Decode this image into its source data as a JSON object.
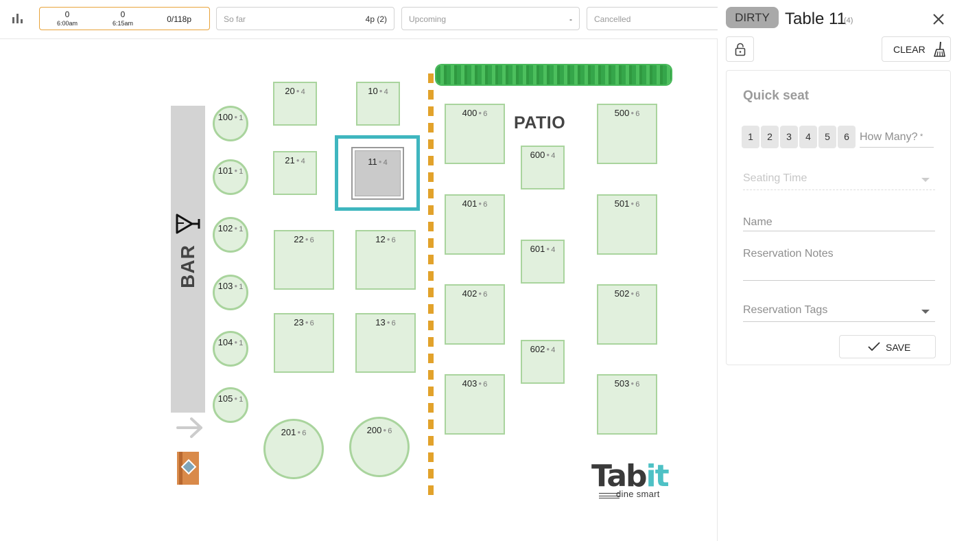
{
  "topbar": {
    "now": {
      "slots": [
        {
          "count": "0",
          "time": "6:00am"
        },
        {
          "count": "0",
          "time": "6:15am"
        }
      ],
      "total": "0/118p"
    },
    "so_far": {
      "label": "So far",
      "value": "4p (2)"
    },
    "upcoming": {
      "label": "Upcoming",
      "value": "-"
    },
    "cancelled": {
      "label": "Cancelled"
    }
  },
  "floor": {
    "bar_label": "BAR",
    "patio_label": "PATIO",
    "logo": {
      "part1": "Tab",
      "part2": "it",
      "tagline": "dine smart"
    },
    "tables": [
      {
        "id": "20",
        "seats": "4"
      },
      {
        "id": "10",
        "seats": "4"
      },
      {
        "id": "21",
        "seats": "4"
      },
      {
        "id": "11",
        "seats": "4"
      },
      {
        "id": "22",
        "seats": "6"
      },
      {
        "id": "12",
        "seats": "6"
      },
      {
        "id": "23",
        "seats": "6"
      },
      {
        "id": "13",
        "seats": "6"
      },
      {
        "id": "201",
        "seats": "6"
      },
      {
        "id": "200",
        "seats": "6"
      },
      {
        "id": "100",
        "seats": "1"
      },
      {
        "id": "101",
        "seats": "1"
      },
      {
        "id": "102",
        "seats": "1"
      },
      {
        "id": "103",
        "seats": "1"
      },
      {
        "id": "104",
        "seats": "1"
      },
      {
        "id": "105",
        "seats": "1"
      },
      {
        "id": "400",
        "seats": "6"
      },
      {
        "id": "401",
        "seats": "6"
      },
      {
        "id": "402",
        "seats": "6"
      },
      {
        "id": "403",
        "seats": "6"
      },
      {
        "id": "600",
        "seats": "4"
      },
      {
        "id": "601",
        "seats": "4"
      },
      {
        "id": "602",
        "seats": "4"
      },
      {
        "id": "500",
        "seats": "6"
      },
      {
        "id": "501",
        "seats": "6"
      },
      {
        "id": "502",
        "seats": "6"
      },
      {
        "id": "503",
        "seats": "6"
      }
    ],
    "selected_table": "11"
  },
  "panel": {
    "status": "DIRTY",
    "title": "Table 11",
    "capacity": "(4)",
    "clear_label": "CLEAR",
    "quick_seat": {
      "title": "Quick seat",
      "party_sizes": [
        "1",
        "2",
        "3",
        "4",
        "5",
        "6"
      ],
      "how_many_placeholder": "How Many?",
      "how_many_required": "*",
      "seating_time_placeholder": "Seating Time",
      "name_placeholder": "Name",
      "notes_placeholder": "Reservation Notes",
      "tags_placeholder": "Reservation Tags",
      "save_label": "SAVE"
    }
  },
  "icons": [
    "stats-icon",
    "cocktail-icon",
    "arrow-right-icon",
    "door-icon",
    "close-icon",
    "lock-icon",
    "broom-icon",
    "check-icon",
    "chevron-down-icon"
  ],
  "colors": {
    "accent": "#3fb6bf",
    "now_border": "#e8a33a",
    "table_fill": "#e1f0dd",
    "table_border": "#a9d49d",
    "divider": "#e2a22b",
    "hedge": "#35a64a",
    "dirty_badge": "#a9a9a9"
  }
}
